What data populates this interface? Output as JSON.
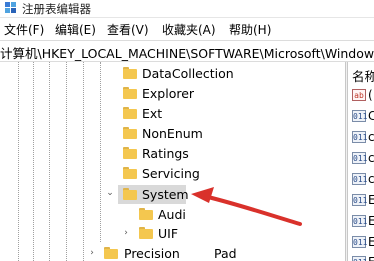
{
  "window": {
    "title": "注册表编辑器",
    "icon": "registry-editor-icon"
  },
  "menu": [
    {
      "label": "文件(F)"
    },
    {
      "label": "编辑(E)"
    },
    {
      "label": "查看(V)"
    },
    {
      "label": "收藏夹(A)"
    },
    {
      "label": "帮助(H)"
    }
  ],
  "address": {
    "path": "计算机\\HKEY_LOCAL_MACHINE\\SOFTWARE\\Microsoft\\Windows\\CurrentVersion"
  },
  "tree": {
    "items": [
      {
        "label": "DataCollection",
        "expanded": false,
        "selected": false
      },
      {
        "label": "Explorer",
        "expanded": false,
        "selected": false
      },
      {
        "label": "Ext",
        "expanded": false,
        "selected": false
      },
      {
        "label": "NonEnum",
        "expanded": false,
        "selected": false
      },
      {
        "label": "Ratings",
        "expanded": false,
        "selected": false
      },
      {
        "label": "Servicing",
        "expanded": false,
        "selected": false
      },
      {
        "label": "System",
        "expanded": true,
        "selected": true
      },
      {
        "label": "Audit",
        "expanded": false,
        "selected": false
      },
      {
        "label": "UIP",
        "expanded": false,
        "selected": false
      },
      {
        "label": "PrecisionTouchPad",
        "expanded": false,
        "selected": false
      }
    ],
    "visible_text": [
      "Audi",
      "UIF",
      "Precision",
      "Pad"
    ]
  },
  "values_pane": {
    "header": "名称",
    "rows": [
      {
        "type_icon": "ab",
        "text": "("
      },
      {
        "type_icon": "011",
        "text": "C"
      },
      {
        "type_icon": "011",
        "text": "c"
      },
      {
        "type_icon": "011",
        "text": "c"
      },
      {
        "type_icon": "011",
        "text": "c"
      },
      {
        "type_icon": "011",
        "text": "E"
      },
      {
        "type_icon": "011",
        "text": "E"
      },
      {
        "type_icon": "011",
        "text": "E"
      },
      {
        "type_icon": "011",
        "text": "F"
      }
    ]
  },
  "annotation": {
    "arrow_color": "#d9312b"
  },
  "colors": {
    "folder": "#f4c74f",
    "selection": "#d9d9d9"
  }
}
